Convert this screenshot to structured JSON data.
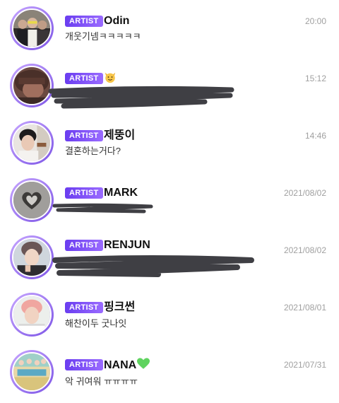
{
  "badge_label": "ARTIST",
  "colors": {
    "badge_start": "#6a3df0",
    "badge_end": "#9a6bff",
    "timestamp": "#a0a0a0",
    "heart": "#5fd35f"
  },
  "chats": [
    {
      "name": "Odin",
      "time": "20:00",
      "message": "개웃기넴ㅋㅋㅋㅋㅋ",
      "message_redacted": false
    },
    {
      "name": "",
      "name_icon": "cat-face-icon",
      "time": "15:12",
      "message": "",
      "message_redacted": true
    },
    {
      "name": "제뚱이",
      "time": "14:46",
      "message": "결혼하는거다?",
      "message_redacted": false
    },
    {
      "name": "MARK",
      "time": "2021/08/02",
      "message": "",
      "message_redacted": true
    },
    {
      "name": "RENJUN",
      "time": "2021/08/02",
      "message": "",
      "message_redacted": true
    },
    {
      "name": "핑크썬",
      "time": "2021/08/01",
      "message": "해찬이두 굿나잇",
      "message_redacted": false
    },
    {
      "name": "NANA",
      "name_icon": "green-heart-icon",
      "time": "2021/07/31",
      "message": "악 귀여워 ㅠㅠㅠㅠ",
      "message_redacted": false
    }
  ]
}
